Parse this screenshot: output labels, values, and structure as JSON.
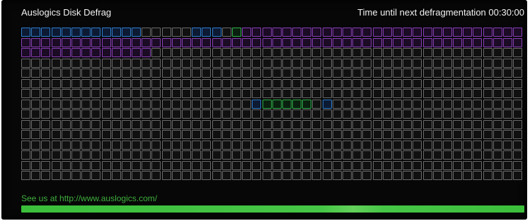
{
  "app": {
    "title": "Auslogics Disk Defrag",
    "countdown_text": "Time until next defragmentation 00:30:00"
  },
  "footer": {
    "link_text": "See us at http://www.auslogics.com/"
  },
  "progress": {
    "fraction": 1.0
  },
  "cluster_map": {
    "columns": 50,
    "rows": 15,
    "default_state": "empty",
    "state_colors": {
      "empty": "#6c6c6c",
      "fragmented": "#2f7fd0",
      "defragmented": "#30b24a",
      "allocated": "#8a3fb8"
    },
    "runs": [
      {
        "row": 0,
        "start": 0,
        "end": 11,
        "state": "fragmented"
      },
      {
        "row": 0,
        "start": 17,
        "end": 19,
        "state": "fragmented"
      },
      {
        "row": 0,
        "start": 21,
        "end": 21,
        "state": "defragmented"
      },
      {
        "row": 0,
        "start": 22,
        "end": 49,
        "state": "allocated"
      },
      {
        "row": 1,
        "start": 0,
        "end": 49,
        "state": "allocated"
      },
      {
        "row": 2,
        "start": 0,
        "end": 12,
        "state": "allocated"
      },
      {
        "row": 7,
        "start": 23,
        "end": 23,
        "state": "fragmented"
      },
      {
        "row": 7,
        "start": 24,
        "end": 28,
        "state": "defragmented"
      },
      {
        "row": 7,
        "start": 30,
        "end": 30,
        "state": "fragmented"
      }
    ]
  }
}
